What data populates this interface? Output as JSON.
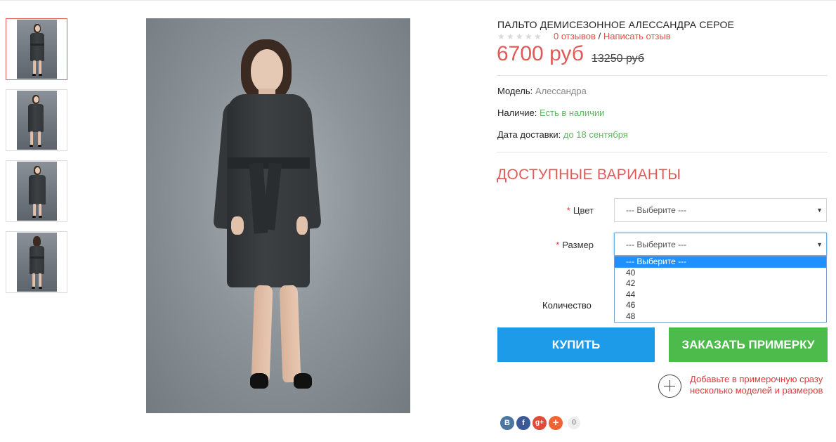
{
  "product": {
    "title": "ПАЛЬТО ДЕМИСЕЗОННОЕ АЛЕССАНДРА СЕРОЕ",
    "rating": 0,
    "reviews_link": "0 отзывов",
    "reviews_separator": "/",
    "write_review_link": "Написать отзыв",
    "price": "6700 руб",
    "old_price": "13250 руб"
  },
  "info": {
    "model_label": "Модель:",
    "model_value": "Алессандра",
    "availability_label": "Наличие:",
    "availability_value": "Есть в наличии",
    "delivery_label": "Дата доставки:",
    "delivery_value": "до 18 сентября"
  },
  "options": {
    "title": "ДОСТУПНЫЕ ВАРИАНТЫ",
    "required_mark": "*",
    "color_label": "Цвет",
    "color_value": "--- Выберите ---",
    "size_label": "Размер",
    "size_value": "--- Выберите ---",
    "size_options": [
      "--- Выберите ---",
      "40",
      "42",
      "44",
      "46",
      "48"
    ],
    "quantity_label": "Количество"
  },
  "buttons": {
    "buy": "КУПИТЬ",
    "fitting": "ЗАКАЗАТЬ ПРИМЕРКУ"
  },
  "fitting_note": "Добавьте в примерочную сразу несколько моделей и размеров",
  "share": {
    "vk": "В",
    "facebook": "f",
    "google_plus": "g+",
    "more": "+",
    "count": "0"
  },
  "colors": {
    "accent_red": "#e05a5a",
    "buy_blue": "#1e9be8",
    "fitting_green": "#4dbb4b",
    "in_stock_green": "#5cb85c",
    "vk": "#4c75a3",
    "facebook": "#3b5998",
    "google_plus": "#dd4b39",
    "share_more": "#f06434"
  },
  "icons": {
    "rating": "star-icon",
    "select": "caret-down-icon",
    "add_fitting": "plus-circle-icon"
  }
}
